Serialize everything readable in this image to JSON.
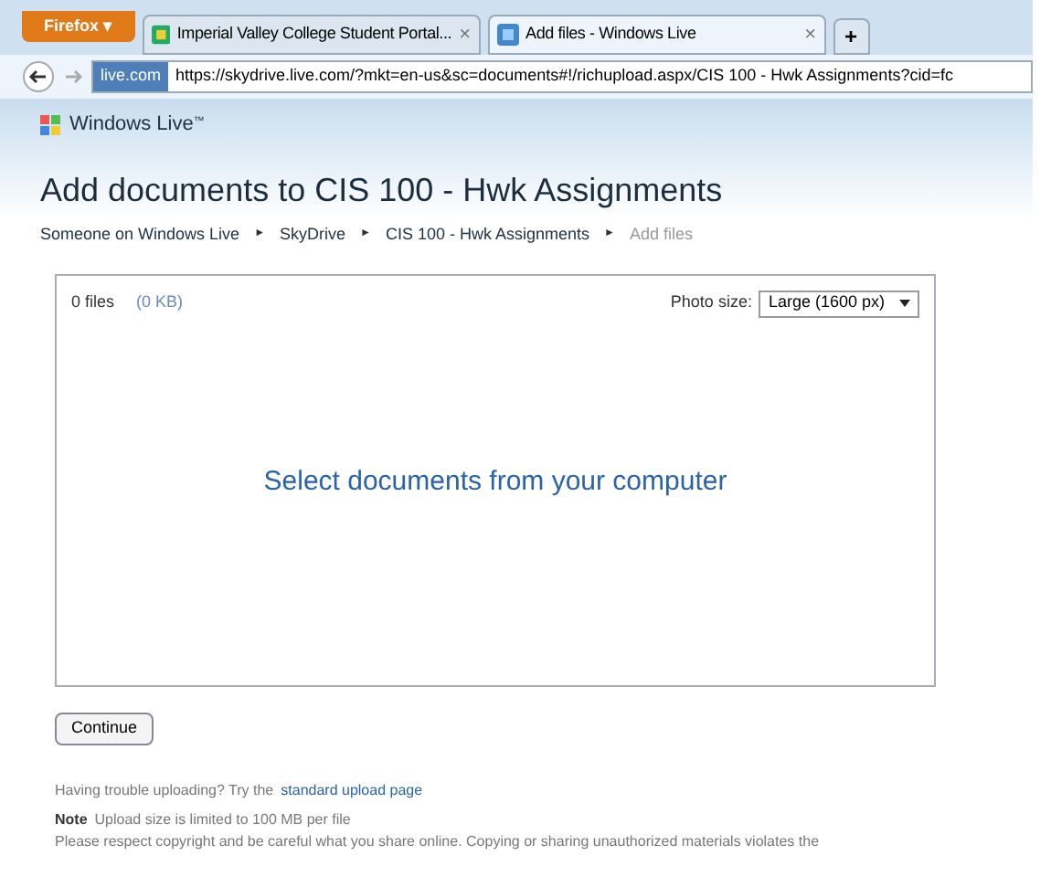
{
  "browser": {
    "menu_button": "Firefox ▾",
    "tabs": [
      {
        "label": "Imperial Valley College Student Portal...",
        "selected": false,
        "close": "×"
      },
      {
        "label": "Add files - Windows Live",
        "selected": true,
        "close": "×"
      }
    ],
    "new_tab": "+",
    "site_badge": "live.com",
    "url": "https://skydrive.live.com/?mkt=en-us&sc=documents#!/richupload.aspx/CIS 100 - Hwk Assignments?cid=fc"
  },
  "brand": "Windows Live",
  "brand_mark": "™",
  "page_title": "Add documents to CIS 100 - Hwk Assignments",
  "breadcrumbs": [
    {
      "label": "Someone on Windows Live",
      "current": false
    },
    {
      "label": "SkyDrive",
      "current": false
    },
    {
      "label": "CIS 100 - Hwk Assignments",
      "current": false
    },
    {
      "label": "Add files",
      "current": true
    }
  ],
  "breadcrumb_separator": "►",
  "upload": {
    "file_count": "0 files",
    "size": "(0 KB)",
    "photo_size_label": "Photo size:",
    "photo_size": "Large (1600 px)",
    "prompt": "Select documents from your computer"
  },
  "continue_button": "Continue",
  "help": {
    "text": "Having trouble uploading? Try the",
    "link": "standard upload page"
  },
  "note": {
    "label": "Note",
    "text": "Upload size is limited to 100 MB per file"
  },
  "copyright": "Please respect copyright and be careful what you share online. Copying or sharing unauthorized materials violates the"
}
